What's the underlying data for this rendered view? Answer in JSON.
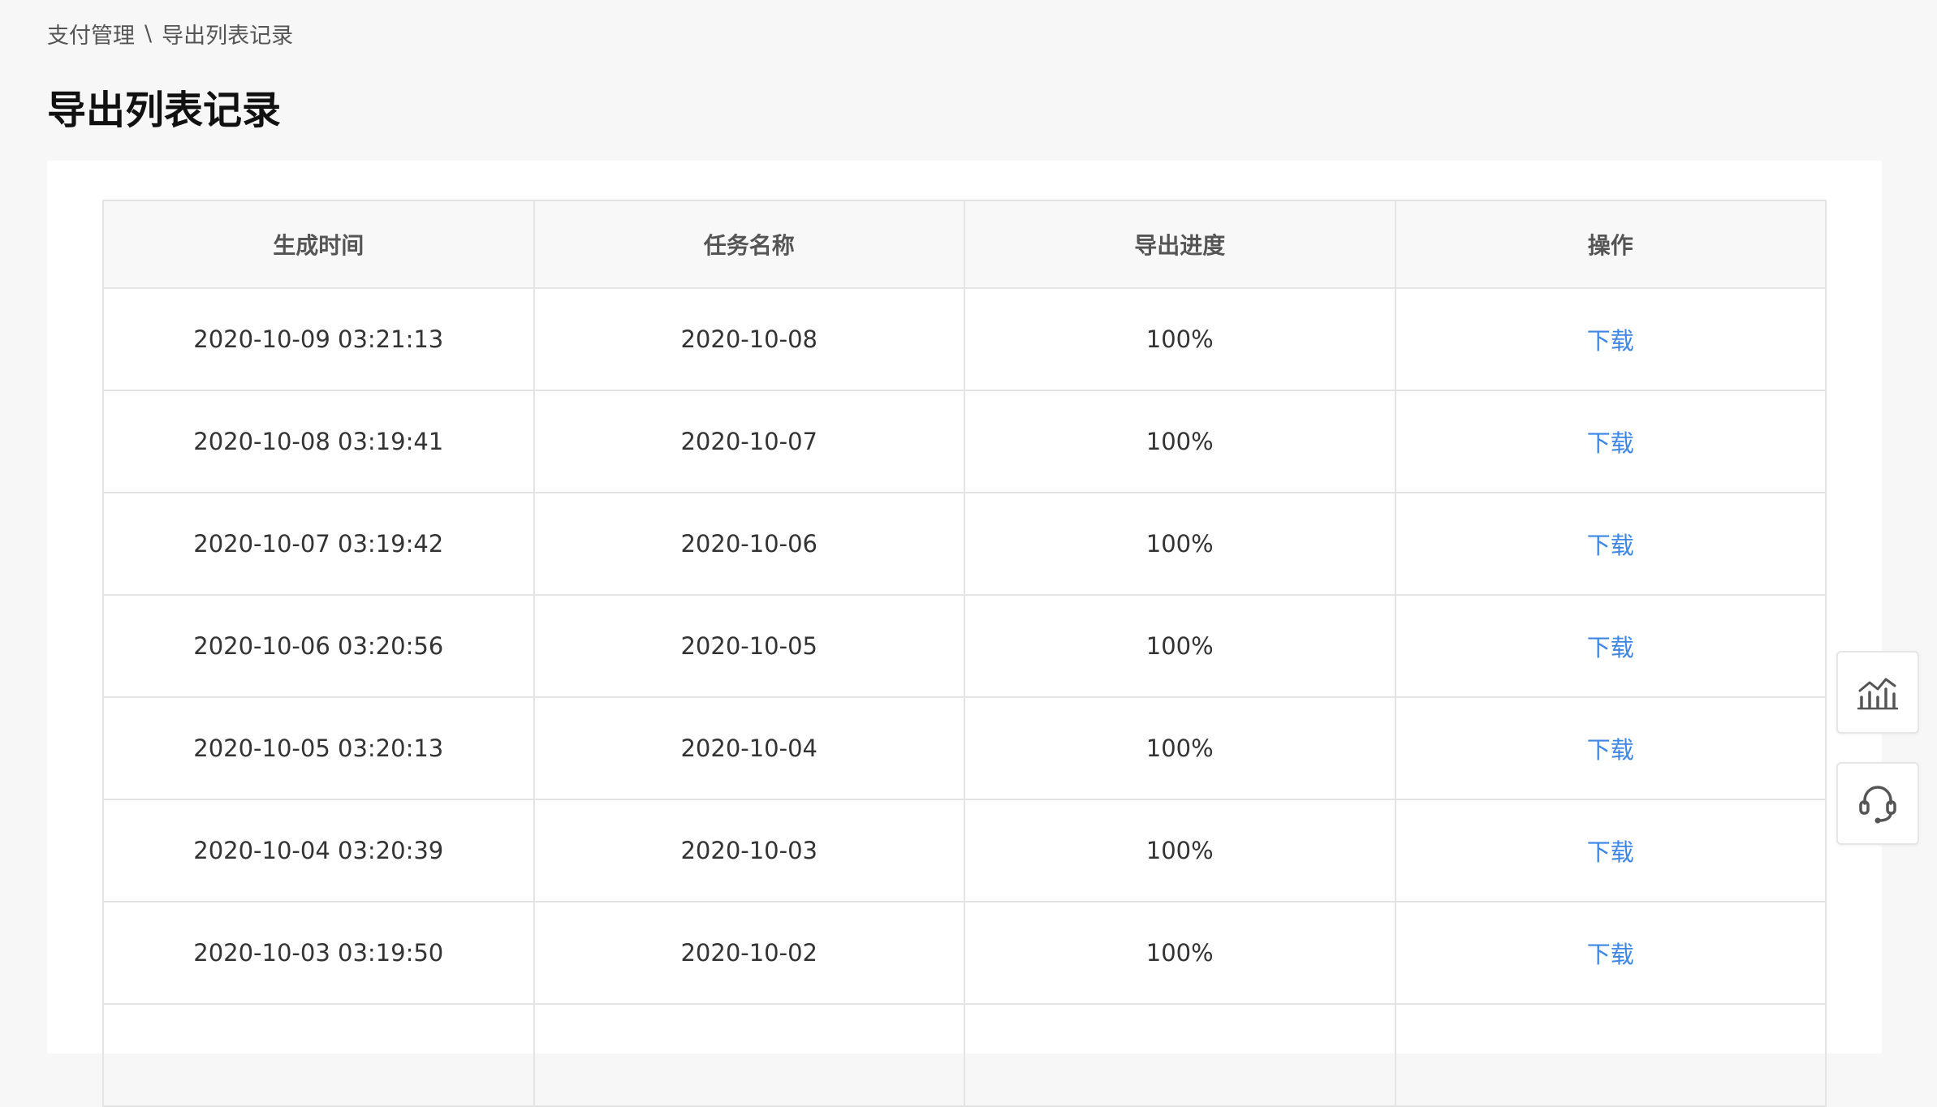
{
  "breadcrumb": {
    "parent": "支付管理",
    "separator": "\\",
    "current": "导出列表记录"
  },
  "page_title": "导出列表记录",
  "table": {
    "headers": {
      "time": "生成时间",
      "task": "任务名称",
      "progress": "导出进度",
      "action": "操作"
    },
    "rows": [
      {
        "time": "2020-10-09 03:21:13",
        "task": "2020-10-08",
        "progress": "100%",
        "action": "下载"
      },
      {
        "time": "2020-10-08 03:19:41",
        "task": "2020-10-07",
        "progress": "100%",
        "action": "下载"
      },
      {
        "time": "2020-10-07 03:19:42",
        "task": "2020-10-06",
        "progress": "100%",
        "action": "下载"
      },
      {
        "time": "2020-10-06 03:20:56",
        "task": "2020-10-05",
        "progress": "100%",
        "action": "下载"
      },
      {
        "time": "2020-10-05 03:20:13",
        "task": "2020-10-04",
        "progress": "100%",
        "action": "下载"
      },
      {
        "time": "2020-10-04 03:20:39",
        "task": "2020-10-03",
        "progress": "100%",
        "action": "下载"
      },
      {
        "time": "2020-10-03 03:19:50",
        "task": "2020-10-02",
        "progress": "100%",
        "action": "下载"
      },
      {
        "time": "",
        "task": "",
        "progress": "",
        "action": ""
      }
    ]
  },
  "float_buttons": [
    {
      "icon": "analytics-chart-icon"
    },
    {
      "icon": "headset-support-icon"
    }
  ],
  "colors": {
    "background": "#f7f7f7",
    "link": "#3d86e6",
    "border": "#e4e4e4",
    "header_bg": "#f8f8f8"
  }
}
